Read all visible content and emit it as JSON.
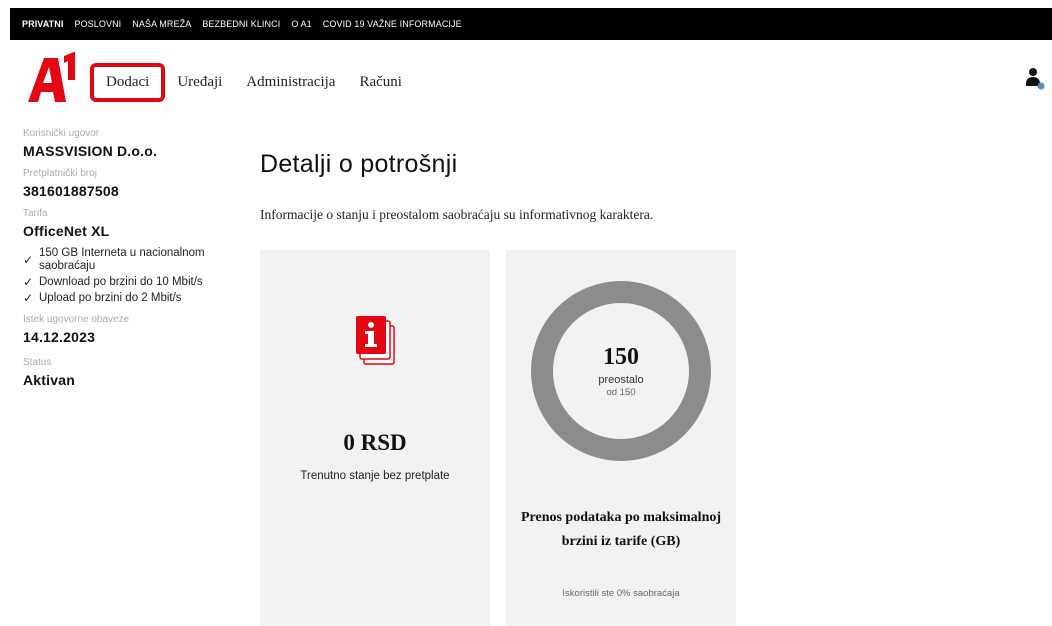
{
  "topnav": [
    "PRIVATNI",
    "POSLOVNI",
    "NAŠA MREŽA",
    "BEZBEDNI KLINCI",
    "O A1",
    "COVID 19 VAŽNE INFORMACIJE"
  ],
  "mainnav": [
    "Dodaci",
    "Uređaji",
    "Administracija",
    "Računi"
  ],
  "icons": {
    "logo": "a1-logo",
    "user": "user-icon",
    "info": "info-icon",
    "check": "check-icon"
  },
  "colors": {
    "brand": "#e30613",
    "donut": "#8c8c8c"
  },
  "sidebar": {
    "contract_label": "Korisnički ugovor",
    "contract_value": "MASSVISION D.o.o.",
    "subscriber_label": "Pretplatnički broj",
    "subscriber_value": "381601887508",
    "tariff_label": "Tarifa",
    "tariff_value": "OfficeNet XL",
    "features": [
      "150 GB Interneta u nacionalnom saobraćaju",
      "Download po brzini do 10 Mbit/s",
      "Upload po brzini do 2 Mbit/s"
    ],
    "expiry_label": "Istek ugovorne obaveze",
    "expiry_value": "14.12.2023",
    "status_label": "Status",
    "status_value": "Aktivan"
  },
  "main": {
    "title": "Detalji o potrošnji",
    "intro": "Informacije o stanju i preostalom saobraćaju su informativnog karaktera.",
    "balance_card": {
      "amount": "0 RSD",
      "description": "Trenutno stanje bez pretplate"
    },
    "data_card": {
      "remaining": "150",
      "remaining_label": "preostalo",
      "of_label": "od 150",
      "used_fraction": 0,
      "title": "Prenos podataka po maksimalnoj brzini iz tarife (GB)",
      "usage_text": "Iskoristili ste 0% saobraćaja"
    }
  }
}
